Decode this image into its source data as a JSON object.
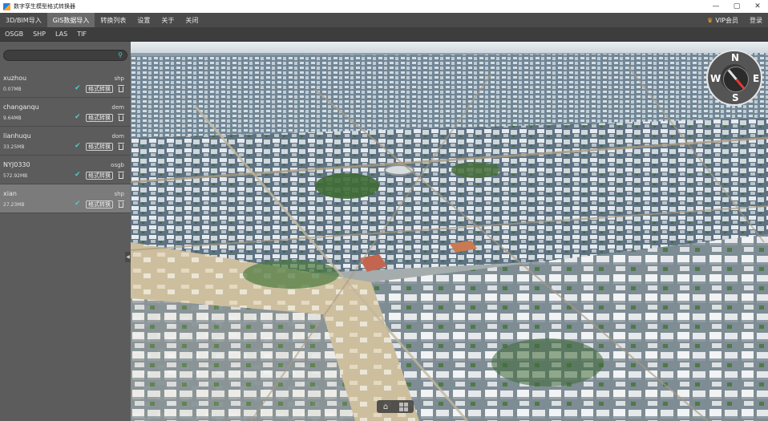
{
  "window": {
    "title": "数字孪生模型格式转换器",
    "controls": {
      "minimize": "—",
      "maximize": "▢",
      "close": "✕"
    }
  },
  "menubar": {
    "items": [
      {
        "label": "3D/BIM导入",
        "active": false
      },
      {
        "label": "GIS数据导入",
        "active": true
      },
      {
        "label": "转换列表",
        "active": false
      },
      {
        "label": "设置",
        "active": false
      },
      {
        "label": "关于",
        "active": false
      },
      {
        "label": "关闭",
        "active": false
      }
    ],
    "vip_label": "VIP会员",
    "login_label": "登录"
  },
  "subbar": {
    "items": [
      "OSGB",
      "SHP",
      "LAS",
      "TIF"
    ]
  },
  "sidebar": {
    "search": {
      "value": "",
      "placeholder": ""
    },
    "convert_label": "格式转换",
    "files": [
      {
        "name": "xuzhou",
        "type": "shp",
        "size": "0.07MB",
        "selected": false
      },
      {
        "name": "changanqu",
        "type": "dem",
        "size": "9.64MB",
        "selected": false
      },
      {
        "name": "lianhuqu",
        "type": "dom",
        "size": "33.25MB",
        "selected": false
      },
      {
        "name": "NYJ0330",
        "type": "osgb",
        "size": "572.92MB",
        "selected": false
      },
      {
        "name": "xian",
        "type": "shp",
        "size": "27.23MB",
        "selected": true
      }
    ]
  },
  "compass": {
    "n": "N",
    "s": "S",
    "e": "E",
    "w": "W"
  },
  "colors": {
    "accent": "#4ecdc4",
    "menubar_bg": "#4a4a4a",
    "sidebar_bg": "#5c5c5c",
    "selected_row": "#7b7b7b",
    "vip_crown": "#f5a623",
    "needle_red": "#e53935"
  }
}
